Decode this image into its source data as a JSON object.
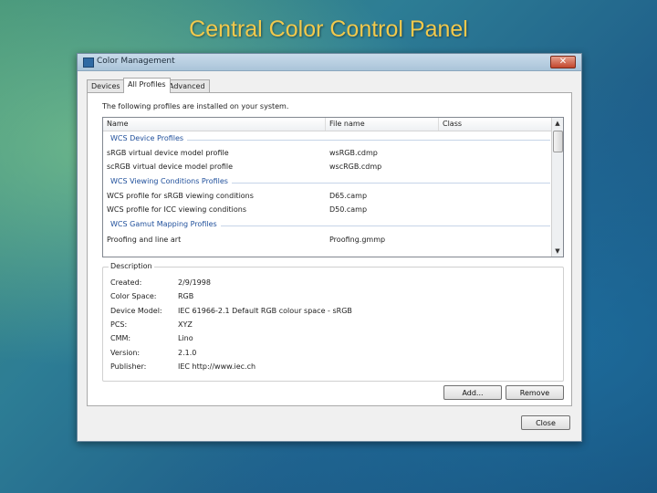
{
  "slide": {
    "title": "Central Color Control Panel"
  },
  "window": {
    "title": "Color Management",
    "close_glyph": "✕"
  },
  "tabs": [
    {
      "label": "Devices"
    },
    {
      "label": "All Profiles"
    },
    {
      "label": "Advanced"
    }
  ],
  "active_tab": "All Profiles",
  "profiles": {
    "intro": "The following profiles are installed on your system.",
    "columns": [
      "Name",
      "File name",
      "Class"
    ],
    "groups": [
      {
        "label": "WCS Device Profiles",
        "items": [
          {
            "name": "sRGB virtual device model profile",
            "file": "wsRGB.cdmp",
            "class": ""
          },
          {
            "name": "scRGB virtual device model profile",
            "file": "wscRGB.cdmp",
            "class": ""
          }
        ]
      },
      {
        "label": "WCS Viewing Conditions Profiles",
        "items": [
          {
            "name": "WCS profile for sRGB viewing conditions",
            "file": "D65.camp",
            "class": ""
          },
          {
            "name": "WCS profile for ICC viewing conditions",
            "file": "D50.camp",
            "class": ""
          }
        ]
      },
      {
        "label": "WCS Gamut Mapping Profiles",
        "items": [
          {
            "name": "Proofing and line art",
            "file": "Proofing.gmmp",
            "class": ""
          }
        ]
      }
    ],
    "scroll_up_glyph": "▲",
    "scroll_down_glyph": "▼"
  },
  "description": {
    "legend": "Description",
    "rows": [
      {
        "label": "Created:",
        "value": "2/9/1998"
      },
      {
        "label": "Color Space:",
        "value": "RGB"
      },
      {
        "label": "Device Model:",
        "value": "IEC 61966-2.1 Default RGB colour space - sRGB"
      },
      {
        "label": "PCS:",
        "value": "XYZ"
      },
      {
        "label": "CMM:",
        "value": "Lino"
      },
      {
        "label": "Version:",
        "value": "2.1.0"
      },
      {
        "label": "Publisher:",
        "value": "IEC http://www.iec.ch"
      }
    ]
  },
  "buttons": {
    "add": "Add...",
    "remove": "Remove",
    "close": "Close"
  }
}
